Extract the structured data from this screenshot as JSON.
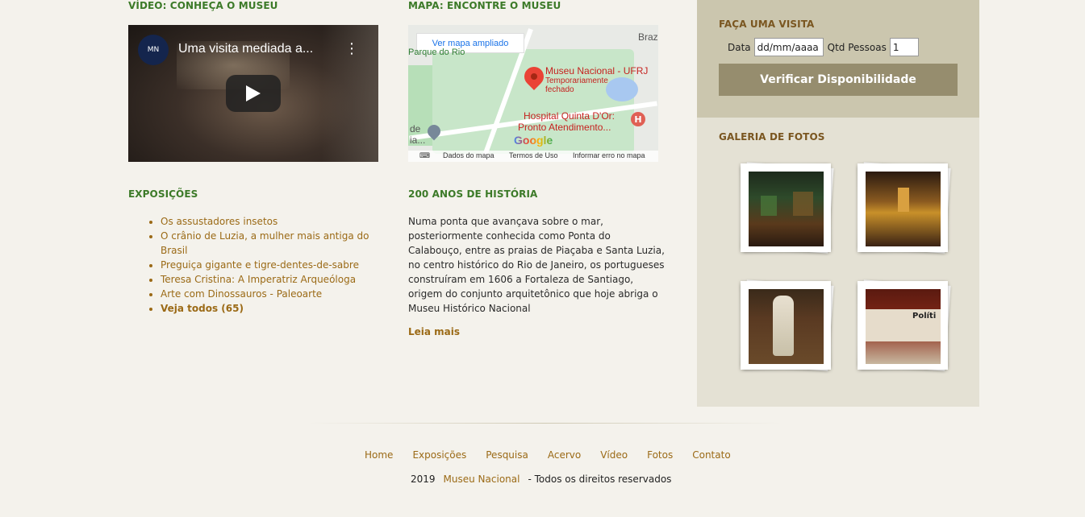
{
  "video_section": {
    "heading": "VÍDEO: CONHEÇA O MUSEU",
    "video_title": "Uma visita mediada a...",
    "channel_logo_text": "MN",
    "menu_glyph": "⋮"
  },
  "map_section": {
    "heading": "MAPA: ENCONTRE O MUSEU",
    "expand_button": "Ver mapa ampliado",
    "place_name": "Museu Nacional - UFRJ",
    "place_status": "Temporariamente",
    "place_status2": "fechado",
    "hospital_label": "Hospital Quinta D'Or:",
    "hospital_label2": "Pronto Atendimento...",
    "park_label": "Parque do Rio",
    "brazil_label": "Braz",
    "left_label1": "de",
    "left_label2": "ia...",
    "google_logo": "Google",
    "footer_data": "Dados do mapa",
    "footer_terms": "Termos de Uso",
    "footer_report": "Informar erro no mapa",
    "hospital_icon": "H"
  },
  "exposicoes": {
    "heading": "EXPOSIÇÕES",
    "items": [
      "Os assustadores insetos",
      "O crânio de Luzia, a mulher mais antiga do Brasil",
      "Preguiça gigante e tigre-dentes-de-sabre",
      "Teresa Cristina: A Imperatriz Arqueóloga",
      "Arte com Dinossauros - Paleoarte"
    ],
    "all_link": "Veja todos (65)"
  },
  "historia": {
    "heading": "200 ANOS DE HISTÓRIA",
    "text": "Numa ponta que avançava sobre o mar, posteriormente conhecida como Ponta do Calabouço, entre as praias de Piaçaba e Santa Luzia, no centro histórico do Rio de Janeiro, os portugueses construíram em 1606 a Fortaleza de Santiago, origem do conjunto arquitetônico que hoje abriga o Museu Histórico Nacional",
    "read_more": "Leia mais"
  },
  "visita": {
    "heading": "FAÇA UMA VISITA",
    "date_label": "Data",
    "date_placeholder": "dd/mm/aaaa",
    "qty_label": "Qtd Pessoas",
    "qty_value": "1",
    "button": "Verificar Disponibilidade"
  },
  "galeria": {
    "heading": "GALERIA DE FOTOS",
    "photos": [
      "museum-hall-dark",
      "museum-exhibit-display",
      "dress-exhibit",
      "politics-exhibit"
    ],
    "photo_sign_text": "Políti"
  },
  "footer": {
    "nav": [
      "Home",
      "Exposições",
      "Pesquisa",
      "Acervo",
      "Vídeo",
      "Fotos",
      "Contato"
    ],
    "year": "2019",
    "org_link": "Museu Nacional",
    "rights": "- Todos os direitos reservados"
  },
  "colors": {
    "green_heading": "#3c7a28",
    "brown_heading": "#7a5620",
    "link": "#9b6a16",
    "sidebar_top": "#cbc6ae",
    "sidebar_bottom": "#e4e1d4",
    "button": "#968d6e"
  }
}
